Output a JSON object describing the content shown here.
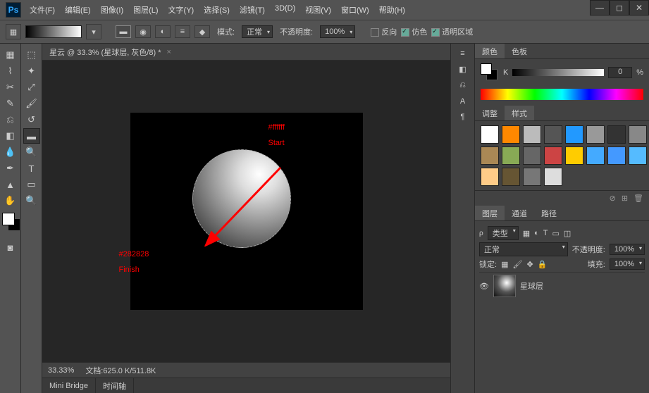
{
  "app": {
    "logo": "Ps"
  },
  "menu": [
    "文件(F)",
    "编辑(E)",
    "图像(I)",
    "图层(L)",
    "文字(Y)",
    "选择(S)",
    "滤镜(T)",
    "3D(D)",
    "视图(V)",
    "窗口(W)",
    "帮助(H)"
  ],
  "optbar": {
    "mode_label": "模式:",
    "mode_value": "正常",
    "opacity_label": "不透明度:",
    "opacity_value": "100%",
    "reverse": "反向",
    "dither": "仿色",
    "transparency": "透明区域"
  },
  "doc": {
    "tab_title": "星云 @ 33.3% (星球层, 灰色/8) *",
    "zoom": "33.33%",
    "docinfo_label": "文档:",
    "docinfo_value": "625.0 K/511.8K"
  },
  "anno": {
    "start_color": "#ffffff",
    "start_label": "Start",
    "finish_color": "#282828",
    "finish_label": "Finish"
  },
  "bottom_tabs": [
    "Mini Bridge",
    "时间轴"
  ],
  "panel_color": {
    "tab_color": "颜色",
    "tab_swatches": "色板",
    "channel": "K",
    "value": "0",
    "percent": "%"
  },
  "panel_styles": {
    "tab_adjust": "调整",
    "tab_styles": "样式"
  },
  "panel_layers": {
    "tab_layers": "图层",
    "tab_channels": "通道",
    "tab_paths": "路径",
    "kind_label": "类型",
    "blend": "正常",
    "opacity_label": "不透明度:",
    "opacity_value": "100%",
    "lock_label": "锁定:",
    "fill_label": "填充:",
    "fill_value": "100%",
    "layer_name": "星球层"
  },
  "style_colors": [
    "#fff",
    "#f80",
    "#bbb",
    "#555",
    "#29f",
    "#999",
    "#333",
    "#888",
    "#a85",
    "#8a5",
    "#666",
    "#c44",
    "#fc0",
    "#4af",
    "#49f",
    "#5bf",
    "#fc8",
    "#653",
    "#777",
    "#ddd"
  ]
}
